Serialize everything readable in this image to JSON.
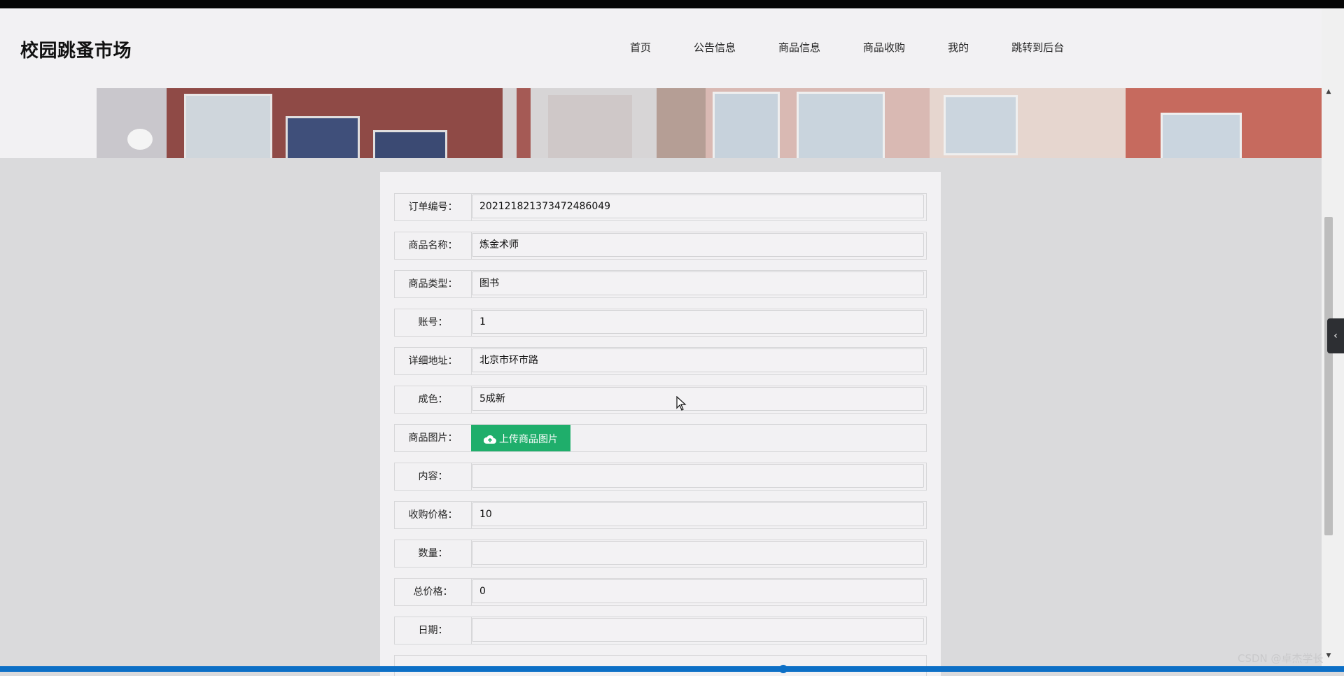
{
  "site": {
    "title": "校园跳蚤市场",
    "nav": [
      "首页",
      "公告信息",
      "商品信息",
      "商品收购",
      "我的",
      "跳转到后台"
    ]
  },
  "form": {
    "fields": [
      {
        "label": "订单编号：",
        "value": "202121821373472486049"
      },
      {
        "label": "商品名称：",
        "value": "炼金术师"
      },
      {
        "label": "商品类型：",
        "value": "图书"
      },
      {
        "label": "账号：",
        "value": "1"
      },
      {
        "label": "详细地址：",
        "value": "北京市环市路"
      },
      {
        "label": "成色：",
        "value": "5成新"
      },
      {
        "label": "商品图片：",
        "button": "上传商品图片"
      },
      {
        "label": "内容：",
        "value": ""
      },
      {
        "label": "收购价格：",
        "value": "10"
      },
      {
        "label": "数量：",
        "value": ""
      },
      {
        "label": "总价格：",
        "value": "0"
      },
      {
        "label": "日期：",
        "value": ""
      }
    ]
  },
  "watermark": "CSDN @卓杰学长",
  "colors": {
    "accent": "#1fae6b",
    "header_bg": "#f2f1f3",
    "page_bg": "#dadadc"
  }
}
